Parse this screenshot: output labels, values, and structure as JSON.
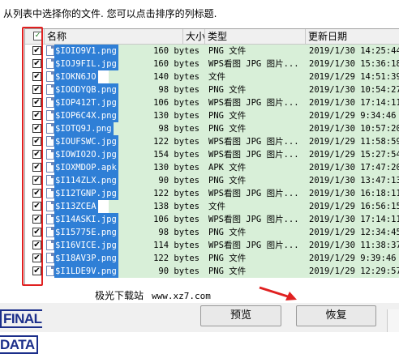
{
  "instruction": "从列表中选择你的文件. 您可以点击排序的列标题.",
  "columns": {
    "name": "名称",
    "size": "大小",
    "type": "类型",
    "date": "更新日期"
  },
  "header_check": "✓",
  "rows": [
    {
      "name": "$IOIO9V1.png",
      "size": "160 bytes",
      "type": "PNG 文件",
      "date": "2019/1/30 14:25:44"
    },
    {
      "name": "$IOJ9FIL.jpg",
      "size": "160 bytes",
      "type": "WPS看图 JPG 图片...",
      "date": "2019/1/30 15:36:18"
    },
    {
      "name": "$IOKN6JO",
      "size": "140 bytes",
      "type": "文件",
      "date": "2019/1/29 14:51:39"
    },
    {
      "name": "$IOODYQB.png",
      "size": "98 bytes",
      "type": "PNG 文件",
      "date": "2019/1/30 10:54:27"
    },
    {
      "name": "$IOP412T.jpg",
      "size": "106 bytes",
      "type": "WPS看图 JPG 图片...",
      "date": "2019/1/30 17:14:11"
    },
    {
      "name": "$IOP6C4X.png",
      "size": "130 bytes",
      "type": "PNG 文件",
      "date": "2019/1/29 9:34:46"
    },
    {
      "name": "$IOTQ9J.png",
      "size": "98 bytes",
      "type": "PNG 文件",
      "date": "2019/1/30 10:57:20"
    },
    {
      "name": "$IOUFSWC.jpg",
      "size": "122 bytes",
      "type": "WPS看图 JPG 图片...",
      "date": "2019/1/29 11:58:59"
    },
    {
      "name": "$IOWIO2O.jpg",
      "size": "154 bytes",
      "type": "WPS看图 JPG 图片...",
      "date": "2019/1/29 15:27:54"
    },
    {
      "name": "$IOXMDOP.apk",
      "size": "130 bytes",
      "type": "APK 文件",
      "date": "2019/1/30 17:47:20"
    },
    {
      "name": "$I114ZLX.png",
      "size": "90 bytes",
      "type": "PNG 文件",
      "date": "2019/1/30 13:47:13"
    },
    {
      "name": "$I12TGNP.jpg",
      "size": "122 bytes",
      "type": "WPS看图 JPG 图片...",
      "date": "2019/1/30 16:18:11"
    },
    {
      "name": "$I13ZCEA",
      "size": "138 bytes",
      "type": "文件",
      "date": "2019/1/29 16:56:15"
    },
    {
      "name": "$I14ASKI.jpg",
      "size": "106 bytes",
      "type": "WPS看图 JPG 图片...",
      "date": "2019/1/30 17:14:11"
    },
    {
      "name": "$I15775E.png",
      "size": "98 bytes",
      "type": "PNG 文件",
      "date": "2019/1/29 12:34:45"
    },
    {
      "name": "$I16VICE.jpg",
      "size": "114 bytes",
      "type": "WPS看图 JPG 图片...",
      "date": "2019/1/30 11:38:37"
    },
    {
      "name": "$I18AV3P.png",
      "size": "122 bytes",
      "type": "PNG 文件",
      "date": "2019/1/29 9:39:46"
    },
    {
      "name": "$I1LDE9V.png",
      "size": "90 bytes",
      "type": "PNG 文件",
      "date": "2019/1/29 12:29:57"
    }
  ],
  "row_check": "✔",
  "watermark": {
    "site": "极光下载站",
    "url": "www.xz7.com"
  },
  "logo": "FINAL DATA",
  "buttons": {
    "preview": "预览",
    "restore": "恢复"
  },
  "colors": {
    "selection": "#2f7fd6",
    "row_highlight": "#d8efd8",
    "annotation": "#e02020",
    "logo": "#1b2e8a"
  }
}
